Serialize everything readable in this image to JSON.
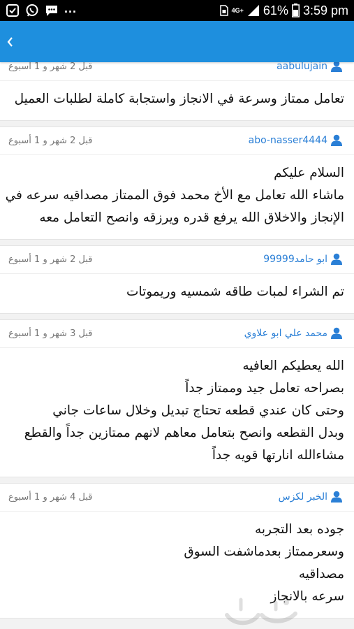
{
  "status_bar": {
    "battery": "61%",
    "time": "3:59 pm",
    "network": "4G+"
  },
  "comments": [
    {
      "user": "aabulujain",
      "time": "قبل 2 شهر و 1 أسبوع",
      "lines": [
        "تعامل ممتاز وسرعة في الانجاز واستجابة كاملة لطلبات العميل"
      ]
    },
    {
      "user": "abo-nasser4444",
      "time": "قبل 2 شهر و 1 أسبوع",
      "lines": [
        "السلام عليكم",
        "ماشاء الله تعامل مع الأخ محمد فوق الممتاز مصداقيه سرعه في",
        "الإنجاز والاخلاق الله يرفع قدره ويرزقه وانصح التعامل معه"
      ]
    },
    {
      "user": "ابو حامد99999",
      "time": "قبل 2 شهر و 1 أسبوع",
      "lines": [
        "تم الشراء لمبات طاقه شمسيه وريموتات"
      ]
    },
    {
      "user": "محمد علي ابو علاوي",
      "time": "قبل 3 شهر و 1 أسبوع",
      "lines": [
        "الله يعطيكم العافيه",
        "بصراحه تعامل جيد وممتاز جداً",
        "وحتى كان عندي قطعه تحتاج تبديل وخلال ساعات جاني",
        "وبدل القطعه وانصح بتعامل معاهم لانهم ممتازين جداً والقطع",
        "مشاءالله انارتها قويه جداً"
      ]
    },
    {
      "user": "الخبر لكزس",
      "time": "قبل 4 شهر و 1 أسبوع",
      "lines": [
        "جوده بعد التجربه",
        "وسعرممتاز بعدماشفت السوق",
        "مصداقيه",
        "سرعه بالانجاز"
      ]
    }
  ],
  "watermark": "حراج",
  "colors": {
    "app_bar": "#1e8fde",
    "username": "#2a7fd6",
    "background": "#f2f2f2"
  }
}
